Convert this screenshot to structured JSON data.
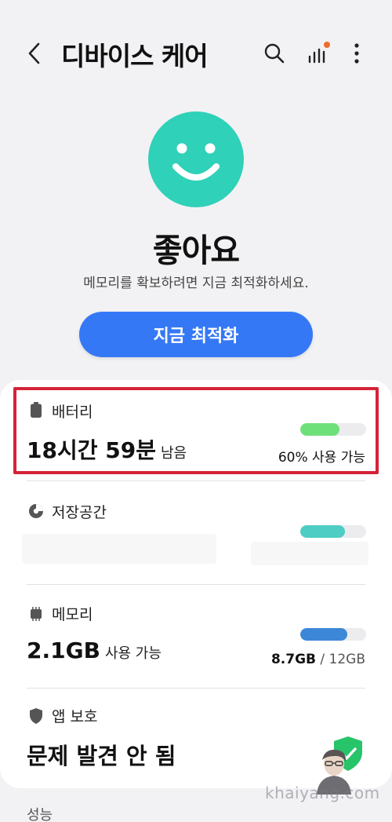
{
  "header": {
    "title": "디바이스 케어"
  },
  "status": {
    "headline": "좋아요",
    "subtitle": "메모리를 확보하려면 지금 최적화하세요.",
    "optimize_label": "지금 최적화"
  },
  "battery": {
    "label": "배터리",
    "time": "18시간 59분",
    "time_suffix": "남음",
    "usage_text": "60% 사용 가능",
    "level": 0.6,
    "color": "#6ee07a"
  },
  "storage": {
    "label": "저장공간",
    "level": 0.68,
    "color": "#4ecdc4"
  },
  "memory": {
    "label": "메모리",
    "value": "2.1GB",
    "value_suffix": "사용 가능",
    "used": "8.7GB",
    "total": "/ 12GB",
    "level": 0.72,
    "color": "#3d87d8"
  },
  "app_protection": {
    "label": "앱 보호",
    "value": "문제 발견 안 됨"
  },
  "performance": {
    "label": "성능"
  },
  "watermark": "khaiyang.com",
  "colors": {
    "accent": "#3478f6",
    "smiley": "#2fd1b8",
    "highlight": "#d4243a",
    "shield": "#27c46a",
    "notification_dot": "#f26b2a"
  }
}
